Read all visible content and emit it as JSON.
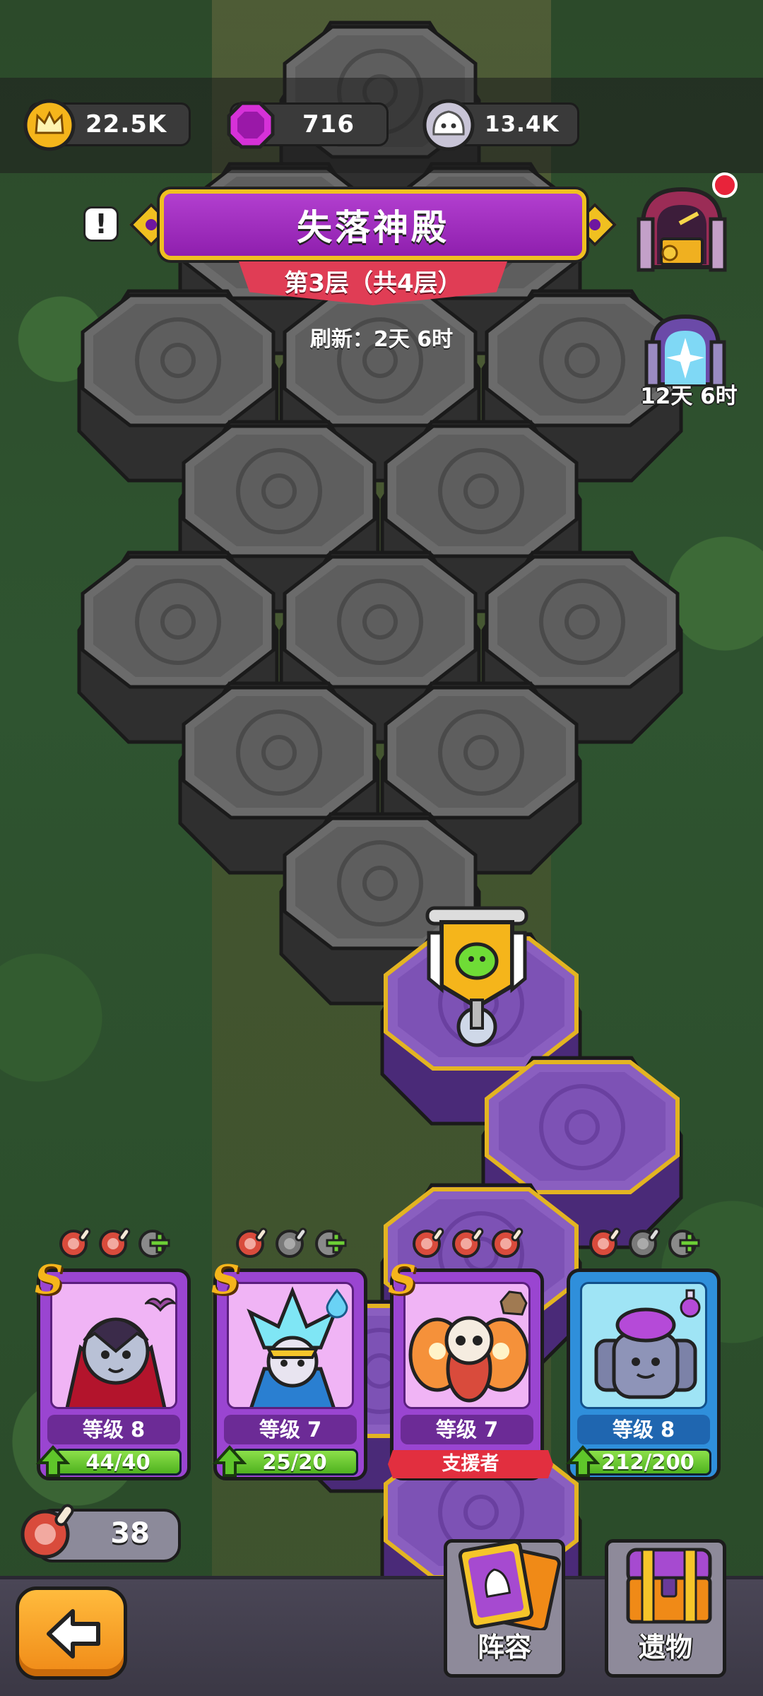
{
  "resources": {
    "crowns": "22.5K",
    "gems": "716",
    "slimes": "13.4K"
  },
  "dungeon": {
    "title": "失落神殿",
    "floor": "第3层（共4层）",
    "refresh": "刷新：2天 6时"
  },
  "side": {
    "portal_timer": "12天 6时"
  },
  "heroes": [
    {
      "rank": "S",
      "level": "等级 8",
      "xp": "44/40",
      "xp_fraction": 1.0,
      "element": "bat-icon",
      "meat": [
        "full",
        "full",
        "add"
      ]
    },
    {
      "rank": "S",
      "level": "等级 7",
      "xp": "25/20",
      "xp_fraction": 1.0,
      "element": "water-drop-icon",
      "meat": [
        "full",
        "empty",
        "add"
      ]
    },
    {
      "rank": "S",
      "level": "等级 7",
      "status": "支援者",
      "element": "rock-icon",
      "meat": [
        "full",
        "full",
        "full"
      ]
    },
    {
      "rank": "",
      "level": "等级 8",
      "xp": "212/200",
      "xp_fraction": 1.0,
      "element": "potion-icon",
      "meat": [
        "full",
        "empty",
        "add"
      ]
    }
  ],
  "meat_count": "38",
  "nav": {
    "lineup": "阵容",
    "relics": "遗物"
  },
  "colors": {
    "banner_purple": "#9a2cc0",
    "banner_gold": "#f0c020",
    "ribbon_red": "#e03d55",
    "xp_green": "#6ccf35",
    "back_orange": "#f5a020"
  }
}
